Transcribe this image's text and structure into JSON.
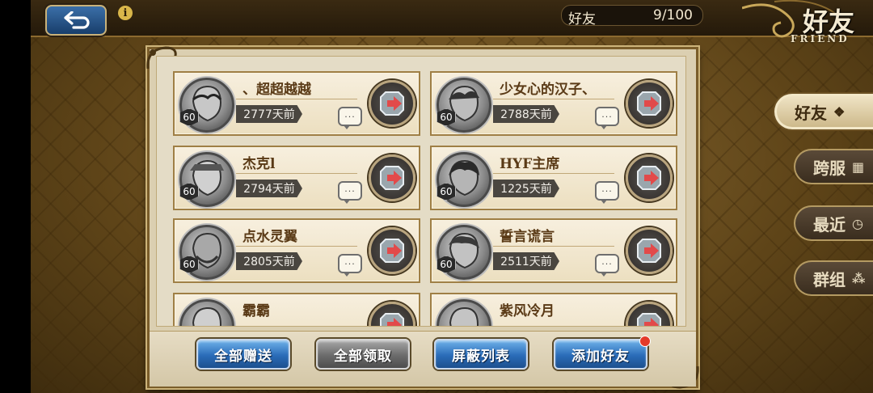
{
  "header": {
    "back_label": "back",
    "info_label": "i",
    "count_label": "好友",
    "count_value": "9/100",
    "title_zh": "好友",
    "title_en": "FRIEND"
  },
  "friends": [
    {
      "name": "、超超越越",
      "level": "60",
      "last_seen": "2777天前"
    },
    {
      "name": "少女心的汉子、",
      "level": "60",
      "last_seen": "2788天前"
    },
    {
      "name": "杰克l",
      "level": "60",
      "last_seen": "2794天前"
    },
    {
      "name": "HYF主席",
      "level": "60",
      "last_seen": "1225天前"
    },
    {
      "name": "点水灵翼",
      "level": "60",
      "last_seen": "2805天前"
    },
    {
      "name": "誓言谎言",
      "level": "60",
      "last_seen": "2511天前"
    },
    {
      "name": "霸霸",
      "level": "",
      "last_seen": ""
    },
    {
      "name": "紫风冷月",
      "level": "",
      "last_seen": ""
    }
  ],
  "chat_glyph": "···",
  "buttons": {
    "gift_all": "全部赠送",
    "claim_all": "全部领取",
    "block_list": "屏蔽列表",
    "add_friend": "添加好友"
  },
  "tabs": {
    "friends": "好友",
    "cross_server": "跨服",
    "recent": "最近",
    "group": "群组"
  },
  "colors": {
    "accent_blue": "#2a6cb8",
    "card_bg": "#f3ead6",
    "badge_red": "#e43a2a"
  }
}
